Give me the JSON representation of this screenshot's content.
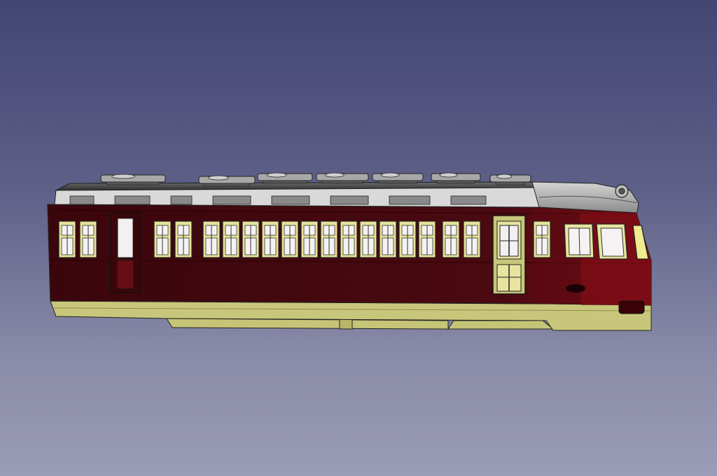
{
  "viewport": {
    "background_top": "#434573",
    "background_bottom": "#9b9cb5"
  },
  "model": {
    "body_color": "#4a0a10",
    "body_highlight": "#6e0c14",
    "trim_color": "#c9c77a",
    "window_color": "#e6e29a",
    "roof_color": "#8a8a8a",
    "roof_dark": "#3a3a3a"
  }
}
